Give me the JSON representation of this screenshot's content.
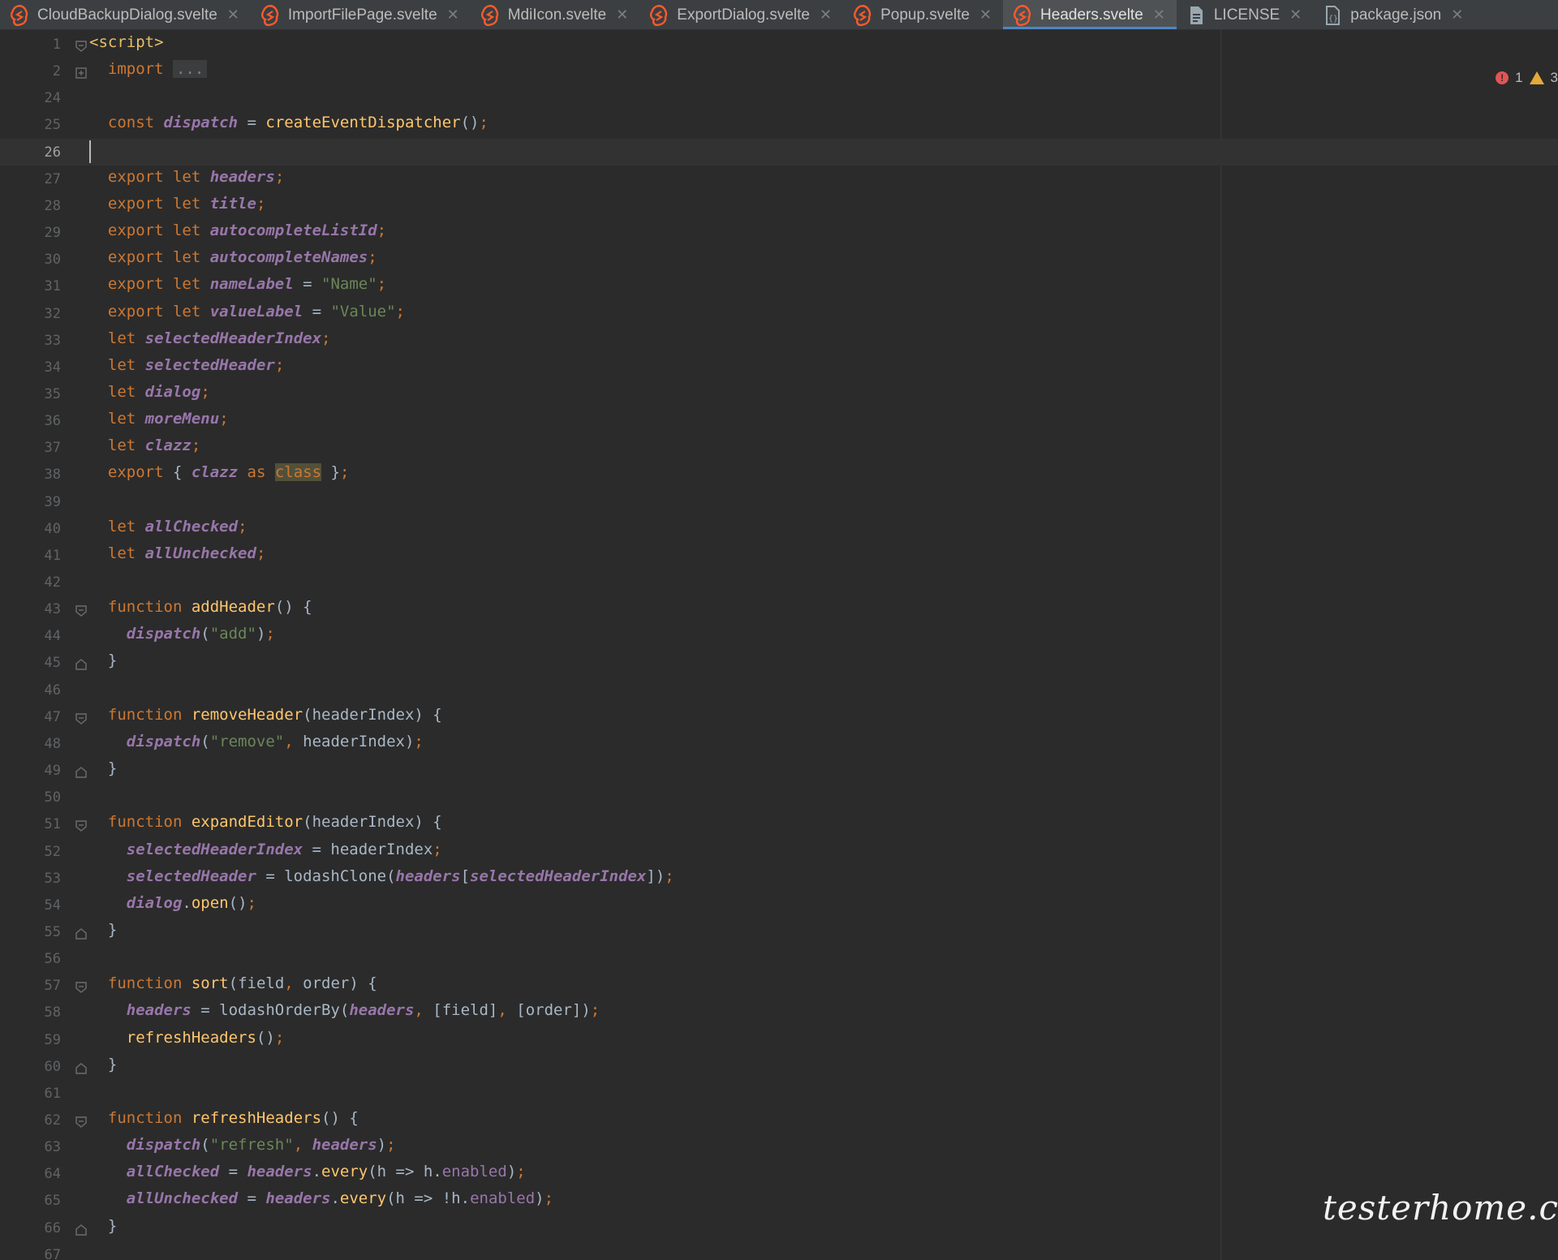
{
  "tabs": [
    {
      "label": "CloudBackupDialog.svelte",
      "icon": "svelte-icon",
      "active": false
    },
    {
      "label": "ImportFilePage.svelte",
      "icon": "svelte-icon",
      "active": false
    },
    {
      "label": "MdiIcon.svelte",
      "icon": "svelte-icon",
      "active": false
    },
    {
      "label": "ExportDialog.svelte",
      "icon": "svelte-icon",
      "active": false
    },
    {
      "label": "Popup.svelte",
      "icon": "svelte-icon",
      "active": false
    },
    {
      "label": "Headers.svelte",
      "icon": "svelte-icon",
      "active": true
    },
    {
      "label": "LICENSE",
      "icon": "text-file-icon",
      "active": false
    },
    {
      "label": "package.json",
      "icon": "json-file-icon",
      "active": false
    }
  ],
  "inspections": {
    "errors": "1",
    "warnings": "3"
  },
  "current_line": "26",
  "watermark": "testerhome.com",
  "colors": {
    "keyword": "#cc7832",
    "function": "#ffc66d",
    "variable": "#9876aa",
    "string": "#6a8759",
    "tag": "#e8bf6a",
    "active_tab_underline": "#4a88c7"
  },
  "code": [
    {
      "n": "1",
      "tokens": [
        [
          "tag",
          "<script>"
        ]
      ],
      "fold": "open"
    },
    {
      "n": "2",
      "tokens": [
        [
          "p",
          "  "
        ],
        [
          "kw",
          "import"
        ],
        [
          "p",
          " "
        ],
        [
          "dots",
          "..."
        ]
      ],
      "fold": "collapsed"
    },
    {
      "n": "24",
      "tokens": []
    },
    {
      "n": "25",
      "tokens": [
        [
          "p",
          "  "
        ],
        [
          "kw",
          "const"
        ],
        [
          "p",
          " "
        ],
        [
          "vi",
          "dispatch"
        ],
        [
          "p",
          " = "
        ],
        [
          "fn",
          "createEventDispatcher"
        ],
        [
          "p",
          "()"
        ],
        [
          "kw",
          ";"
        ]
      ]
    },
    {
      "n": "26",
      "tokens": []
    },
    {
      "n": "27",
      "tokens": [
        [
          "p",
          "  "
        ],
        [
          "kw",
          "export let"
        ],
        [
          "p",
          " "
        ],
        [
          "vi",
          "headers"
        ],
        [
          "kw",
          ";"
        ]
      ]
    },
    {
      "n": "28",
      "tokens": [
        [
          "p",
          "  "
        ],
        [
          "kw",
          "export let"
        ],
        [
          "p",
          " "
        ],
        [
          "vi",
          "title"
        ],
        [
          "kw",
          ";"
        ]
      ]
    },
    {
      "n": "29",
      "tokens": [
        [
          "p",
          "  "
        ],
        [
          "kw",
          "export let"
        ],
        [
          "p",
          " "
        ],
        [
          "vi",
          "autocompleteListId"
        ],
        [
          "kw",
          ";"
        ]
      ]
    },
    {
      "n": "30",
      "tokens": [
        [
          "p",
          "  "
        ],
        [
          "kw",
          "export let"
        ],
        [
          "p",
          " "
        ],
        [
          "vi",
          "autocompleteNames"
        ],
        [
          "kw",
          ";"
        ]
      ]
    },
    {
      "n": "31",
      "tokens": [
        [
          "p",
          "  "
        ],
        [
          "kw",
          "export let"
        ],
        [
          "p",
          " "
        ],
        [
          "vi",
          "nameLabel"
        ],
        [
          "p",
          " = "
        ],
        [
          "str",
          "\"Name\""
        ],
        [
          "kw",
          ";"
        ]
      ]
    },
    {
      "n": "32",
      "tokens": [
        [
          "p",
          "  "
        ],
        [
          "kw",
          "export let"
        ],
        [
          "p",
          " "
        ],
        [
          "vi",
          "valueLabel"
        ],
        [
          "p",
          " = "
        ],
        [
          "str",
          "\"Value\""
        ],
        [
          "kw",
          ";"
        ]
      ]
    },
    {
      "n": "33",
      "tokens": [
        [
          "p",
          "  "
        ],
        [
          "kw",
          "let"
        ],
        [
          "p",
          " "
        ],
        [
          "vi",
          "selectedHeaderIndex"
        ],
        [
          "kw",
          ";"
        ]
      ]
    },
    {
      "n": "34",
      "tokens": [
        [
          "p",
          "  "
        ],
        [
          "kw",
          "let"
        ],
        [
          "p",
          " "
        ],
        [
          "vi",
          "selectedHeader"
        ],
        [
          "kw",
          ";"
        ]
      ]
    },
    {
      "n": "35",
      "tokens": [
        [
          "p",
          "  "
        ],
        [
          "kw",
          "let"
        ],
        [
          "p",
          " "
        ],
        [
          "vi",
          "dialog"
        ],
        [
          "kw",
          ";"
        ]
      ]
    },
    {
      "n": "36",
      "tokens": [
        [
          "p",
          "  "
        ],
        [
          "kw",
          "let"
        ],
        [
          "p",
          " "
        ],
        [
          "vi",
          "moreMenu"
        ],
        [
          "kw",
          ";"
        ]
      ]
    },
    {
      "n": "37",
      "tokens": [
        [
          "p",
          "  "
        ],
        [
          "kw",
          "let"
        ],
        [
          "p",
          " "
        ],
        [
          "vi",
          "clazz"
        ],
        [
          "kw",
          ";"
        ]
      ]
    },
    {
      "n": "38",
      "tokens": [
        [
          "p",
          "  "
        ],
        [
          "kw",
          "export"
        ],
        [
          "p",
          " { "
        ],
        [
          "vi",
          "clazz"
        ],
        [
          "p",
          " "
        ],
        [
          "kw",
          "as"
        ],
        [
          "p",
          " "
        ],
        [
          "hl",
          "class"
        ],
        [
          "p",
          " }"
        ],
        [
          "kw",
          ";"
        ]
      ]
    },
    {
      "n": "39",
      "tokens": []
    },
    {
      "n": "40",
      "tokens": [
        [
          "p",
          "  "
        ],
        [
          "kw",
          "let"
        ],
        [
          "p",
          " "
        ],
        [
          "vi",
          "allChecked"
        ],
        [
          "kw",
          ";"
        ]
      ]
    },
    {
      "n": "41",
      "tokens": [
        [
          "p",
          "  "
        ],
        [
          "kw",
          "let"
        ],
        [
          "p",
          " "
        ],
        [
          "vi",
          "allUnchecked"
        ],
        [
          "kw",
          ";"
        ]
      ]
    },
    {
      "n": "42",
      "tokens": []
    },
    {
      "n": "43",
      "tokens": [
        [
          "p",
          "  "
        ],
        [
          "kw",
          "function"
        ],
        [
          "p",
          " "
        ],
        [
          "fn",
          "addHeader"
        ],
        [
          "p",
          "() {"
        ]
      ],
      "fold": "open"
    },
    {
      "n": "44",
      "tokens": [
        [
          "p",
          "    "
        ],
        [
          "vi",
          "dispatch"
        ],
        [
          "p",
          "("
        ],
        [
          "str",
          "\"add\""
        ],
        [
          "p",
          ")"
        ],
        [
          "kw",
          ";"
        ]
      ]
    },
    {
      "n": "45",
      "tokens": [
        [
          "p",
          "  }"
        ]
      ],
      "fold": "end"
    },
    {
      "n": "46",
      "tokens": []
    },
    {
      "n": "47",
      "tokens": [
        [
          "p",
          "  "
        ],
        [
          "kw",
          "function"
        ],
        [
          "p",
          " "
        ],
        [
          "fn",
          "removeHeader"
        ],
        [
          "p",
          "(headerIndex) {"
        ]
      ],
      "fold": "open"
    },
    {
      "n": "48",
      "tokens": [
        [
          "p",
          "    "
        ],
        [
          "vi",
          "dispatch"
        ],
        [
          "p",
          "("
        ],
        [
          "str",
          "\"remove\""
        ],
        [
          "kw",
          ","
        ],
        [
          "p",
          " headerIndex)"
        ],
        [
          "kw",
          ";"
        ]
      ]
    },
    {
      "n": "49",
      "tokens": [
        [
          "p",
          "  }"
        ]
      ],
      "fold": "end"
    },
    {
      "n": "50",
      "tokens": []
    },
    {
      "n": "51",
      "tokens": [
        [
          "p",
          "  "
        ],
        [
          "kw",
          "function"
        ],
        [
          "p",
          " "
        ],
        [
          "fn",
          "expandEditor"
        ],
        [
          "p",
          "(headerIndex) {"
        ]
      ],
      "fold": "open"
    },
    {
      "n": "52",
      "tokens": [
        [
          "p",
          "    "
        ],
        [
          "vi",
          "selectedHeaderIndex"
        ],
        [
          "p",
          " = headerIndex"
        ],
        [
          "kw",
          ";"
        ]
      ]
    },
    {
      "n": "53",
      "tokens": [
        [
          "p",
          "    "
        ],
        [
          "vi",
          "selectedHeader"
        ],
        [
          "p",
          " = lodashClone("
        ],
        [
          "vi",
          "headers"
        ],
        [
          "p",
          "["
        ],
        [
          "vi",
          "selectedHeaderIndex"
        ],
        [
          "p",
          "])"
        ],
        [
          "kw",
          ";"
        ]
      ]
    },
    {
      "n": "54",
      "tokens": [
        [
          "p",
          "    "
        ],
        [
          "vi",
          "dialog"
        ],
        [
          "p",
          "."
        ],
        [
          "fn",
          "open"
        ],
        [
          "p",
          "()"
        ],
        [
          "kw",
          ";"
        ]
      ]
    },
    {
      "n": "55",
      "tokens": [
        [
          "p",
          "  }"
        ]
      ],
      "fold": "end"
    },
    {
      "n": "56",
      "tokens": []
    },
    {
      "n": "57",
      "tokens": [
        [
          "p",
          "  "
        ],
        [
          "kw",
          "function"
        ],
        [
          "p",
          " "
        ],
        [
          "fn",
          "sort"
        ],
        [
          "p",
          "(field"
        ],
        [
          "kw",
          ","
        ],
        [
          "p",
          " order) {"
        ]
      ],
      "fold": "open"
    },
    {
      "n": "58",
      "tokens": [
        [
          "p",
          "    "
        ],
        [
          "vi",
          "headers"
        ],
        [
          "p",
          " = lodashOrderBy("
        ],
        [
          "vi",
          "headers"
        ],
        [
          "kw",
          ","
        ],
        [
          "p",
          " [field]"
        ],
        [
          "kw",
          ","
        ],
        [
          "p",
          " [order])"
        ],
        [
          "kw",
          ";"
        ]
      ]
    },
    {
      "n": "59",
      "tokens": [
        [
          "p",
          "    "
        ],
        [
          "fn",
          "refreshHeaders"
        ],
        [
          "p",
          "()"
        ],
        [
          "kw",
          ";"
        ]
      ]
    },
    {
      "n": "60",
      "tokens": [
        [
          "p",
          "  }"
        ]
      ],
      "fold": "end"
    },
    {
      "n": "61",
      "tokens": []
    },
    {
      "n": "62",
      "tokens": [
        [
          "p",
          "  "
        ],
        [
          "kw",
          "function"
        ],
        [
          "p",
          " "
        ],
        [
          "fn",
          "refreshHeaders"
        ],
        [
          "p",
          "() {"
        ]
      ],
      "fold": "open"
    },
    {
      "n": "63",
      "tokens": [
        [
          "p",
          "    "
        ],
        [
          "vi",
          "dispatch"
        ],
        [
          "p",
          "("
        ],
        [
          "str",
          "\"refresh\""
        ],
        [
          "kw",
          ","
        ],
        [
          "p",
          " "
        ],
        [
          "vi",
          "headers"
        ],
        [
          "p",
          ")"
        ],
        [
          "kw",
          ";"
        ]
      ]
    },
    {
      "n": "64",
      "tokens": [
        [
          "p",
          "    "
        ],
        [
          "vi",
          "allChecked"
        ],
        [
          "p",
          " = "
        ],
        [
          "vi",
          "headers"
        ],
        [
          "p",
          "."
        ],
        [
          "fn",
          "every"
        ],
        [
          "p",
          "(h => h."
        ],
        [
          "prop",
          "enabled"
        ],
        [
          "p",
          ")"
        ],
        [
          "kw",
          ";"
        ]
      ]
    },
    {
      "n": "65",
      "tokens": [
        [
          "p",
          "    "
        ],
        [
          "vi",
          "allUnchecked"
        ],
        [
          "p",
          " = "
        ],
        [
          "vi",
          "headers"
        ],
        [
          "p",
          "."
        ],
        [
          "fn",
          "every"
        ],
        [
          "p",
          "(h => !h."
        ],
        [
          "prop",
          "enabled"
        ],
        [
          "p",
          ")"
        ],
        [
          "kw",
          ";"
        ]
      ]
    },
    {
      "n": "66",
      "tokens": [
        [
          "p",
          "  }"
        ]
      ],
      "fold": "end"
    },
    {
      "n": "67",
      "tokens": []
    }
  ]
}
